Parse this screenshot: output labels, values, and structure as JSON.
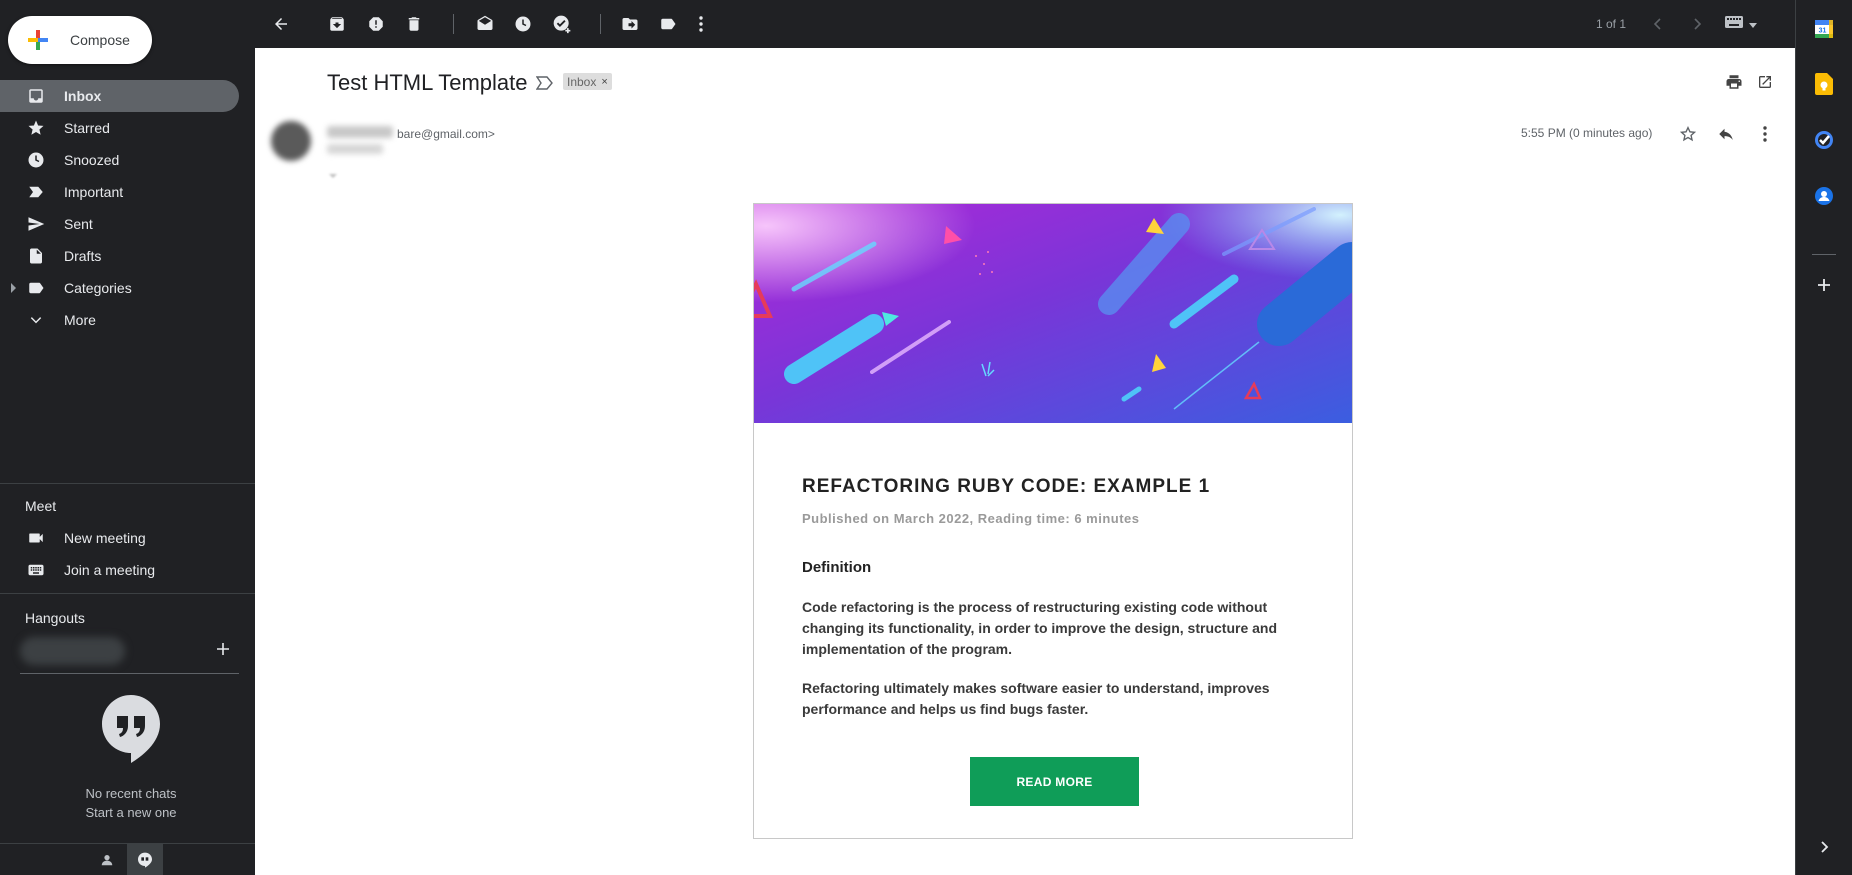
{
  "compose": {
    "label": "Compose"
  },
  "nav": {
    "inbox": "Inbox",
    "starred": "Starred",
    "snoozed": "Snoozed",
    "important": "Important",
    "sent": "Sent",
    "drafts": "Drafts",
    "categories": "Categories",
    "more": "More"
  },
  "meet": {
    "title": "Meet",
    "new_meeting": "New meeting",
    "join_meeting": "Join a meeting"
  },
  "hangouts": {
    "title": "Hangouts",
    "no_chats": "No recent chats",
    "start_new": "Start a new one"
  },
  "toolbar": {
    "pager": "1 of 1"
  },
  "email": {
    "subject": "Test HTML Template",
    "label": "Inbox",
    "label_remove": "×",
    "sender_email_partial": "bare@gmail.com>",
    "time": "5:55 PM (0 minutes ago)"
  },
  "post": {
    "title": "REFACTORING RUBY CODE: EXAMPLE 1",
    "meta": "Published on March 2022, Reading time: 6 minutes",
    "definition_heading": "Definition",
    "paragraph1": "Code refactoring is the process of restructuring existing code without changing its functionality, in order to improve the design, structure and implementation of the program.",
    "paragraph2": "Refactoring ultimately makes software easier to understand, improves performance and helps us find bugs faster.",
    "button": "READ MORE"
  },
  "rail": {
    "calendar_day": "31"
  },
  "colors": {
    "active_nav": "#5f6368",
    "read_more_button": "#0f9d58",
    "banner_purple": "#8a2be2",
    "banner_blue": "#3b6fe0"
  }
}
